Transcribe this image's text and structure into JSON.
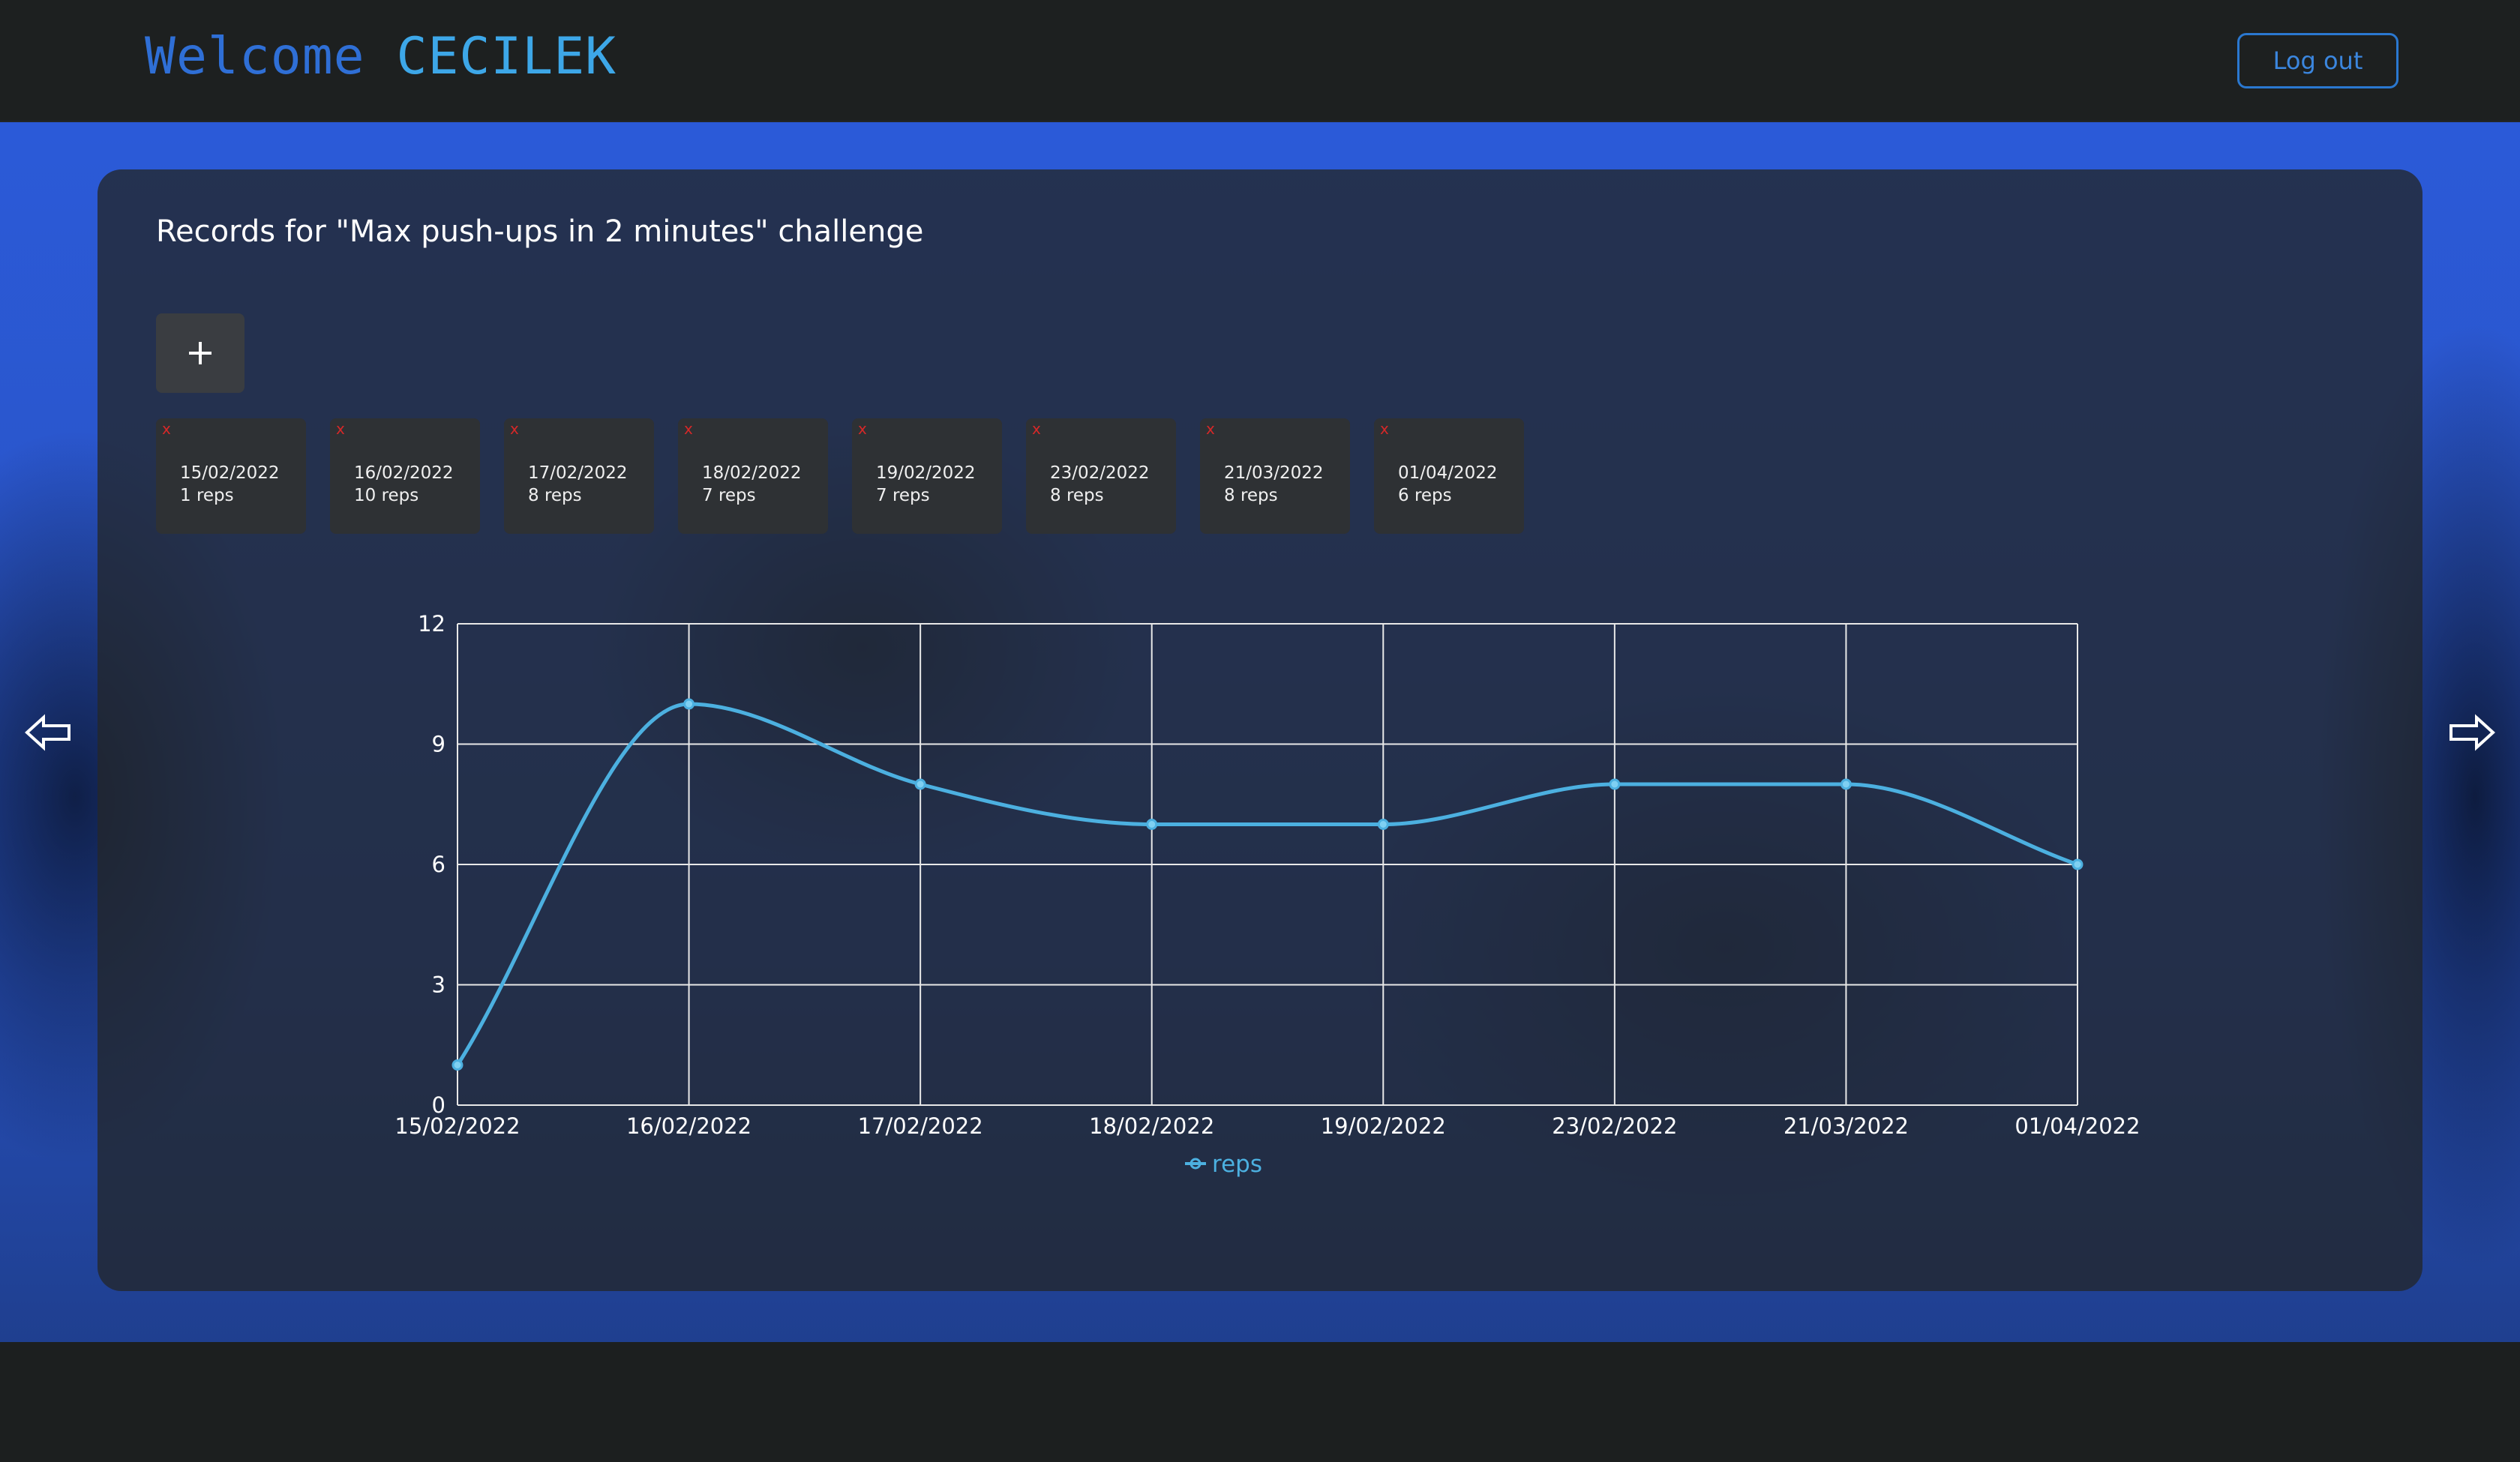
{
  "header": {
    "welcome_prefix": "Welcome ",
    "username": "CECILEK",
    "logout_label": "Log out"
  },
  "colors": {
    "accent_blue": "#2f6fd6",
    "line_color": "#4cb0e0",
    "delete_red": "#d62828"
  },
  "icons": {
    "add": "plus-icon",
    "delete": "close-icon",
    "prev": "arrow-left-icon",
    "next": "arrow-right-icon"
  },
  "main": {
    "title": "Records for \"Max push-ups in 2 minutes\" challenge",
    "add_label": "+",
    "delete_label": "x",
    "records": [
      {
        "date": "15/02/2022",
        "reps": "1 reps"
      },
      {
        "date": "16/02/2022",
        "reps": "10 reps"
      },
      {
        "date": "17/02/2022",
        "reps": "8 reps"
      },
      {
        "date": "18/02/2022",
        "reps": "7 reps"
      },
      {
        "date": "19/02/2022",
        "reps": "7 reps"
      },
      {
        "date": "23/02/2022",
        "reps": "8 reps"
      },
      {
        "date": "21/03/2022",
        "reps": "8 reps"
      },
      {
        "date": "01/04/2022",
        "reps": "6 reps"
      }
    ]
  },
  "chart_data": {
    "type": "line",
    "categories": [
      "15/02/2022",
      "16/02/2022",
      "17/02/2022",
      "18/02/2022",
      "19/02/2022",
      "23/02/2022",
      "21/03/2022",
      "01/04/2022"
    ],
    "series": [
      {
        "name": "reps",
        "values": [
          1,
          10,
          8,
          7,
          7,
          8,
          8,
          6
        ]
      }
    ],
    "ylim": [
      0,
      12
    ],
    "yticks": [
      0,
      3,
      6,
      9,
      12
    ],
    "grid": true,
    "legend": "bottom-center",
    "smooth": true
  }
}
